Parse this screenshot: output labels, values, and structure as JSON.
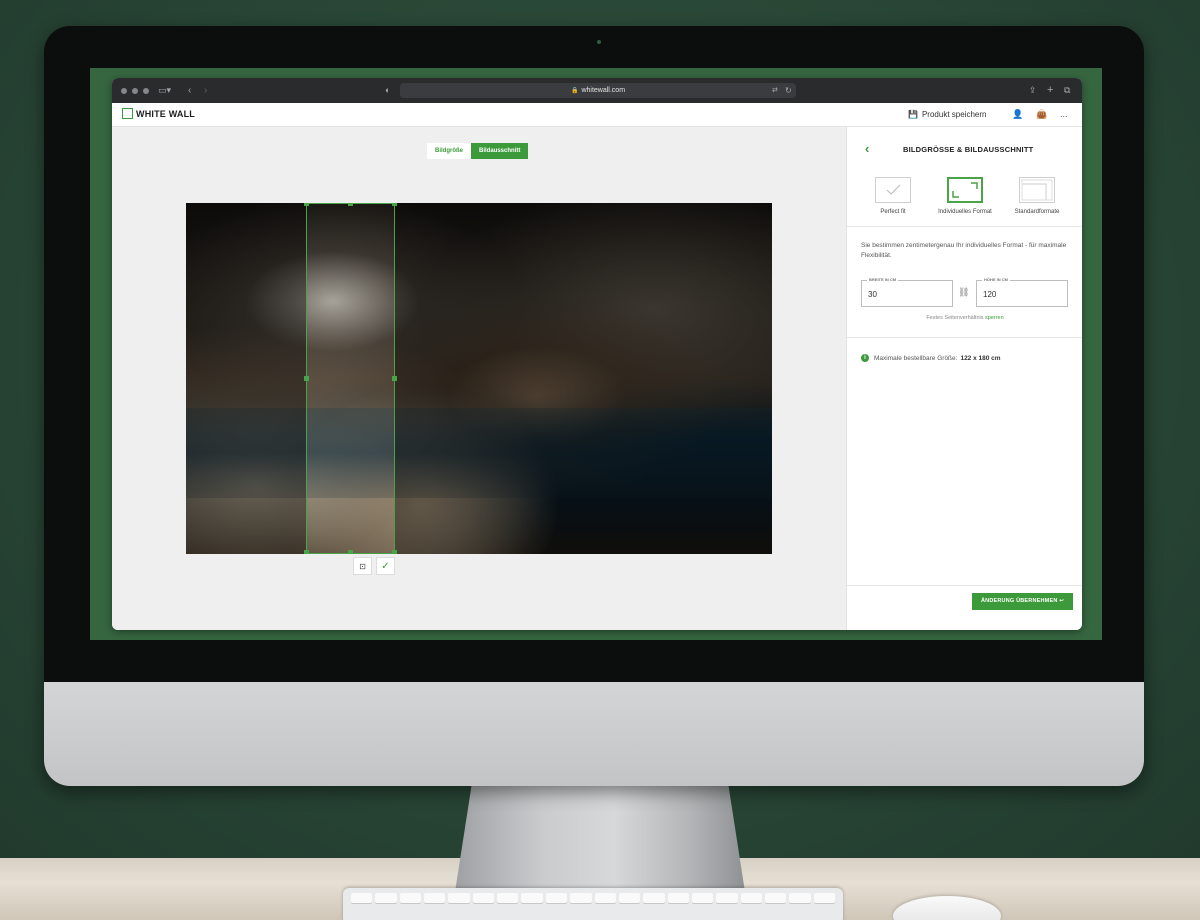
{
  "browser": {
    "url": "whitewall.com"
  },
  "site": {
    "logo_text": "WHITE WALL",
    "save_product": "Produkt speichern",
    "more": "..."
  },
  "editor": {
    "tabs": [
      {
        "label": "Bildgröße",
        "active": false
      },
      {
        "label": "Bildausschnitt",
        "active": true
      }
    ],
    "crop_tools": [
      "focus-icon",
      "check-icon"
    ]
  },
  "panel": {
    "title": "BILDGRÖSSE & BILDAUSSCHNITT",
    "options": [
      {
        "label": "Perfect fit",
        "selected": false
      },
      {
        "label": "Individuelles Format",
        "selected": true
      },
      {
        "label": "Standardformate",
        "selected": false
      }
    ],
    "description": "Sie bestimmen zentimetergenau Ihr individuelles Format - für maximale Flexibilität.",
    "width_label": "BREITE IN CM",
    "width_value": "30",
    "height_label": "HÖHE IN CM",
    "height_value": "120",
    "ratio_text": "Festes Seitenverhältnis",
    "ratio_link": "sperren",
    "info_text": "Maximale bestellbare Größe:",
    "info_value": "122 x 180 cm",
    "apply_label": "ÄNDERUNG ÜBERNEHMEN ↩"
  },
  "colors": {
    "accent": "#3d9a3a",
    "toolbar": "#2a2b2d",
    "editor_bg": "#efefef"
  }
}
